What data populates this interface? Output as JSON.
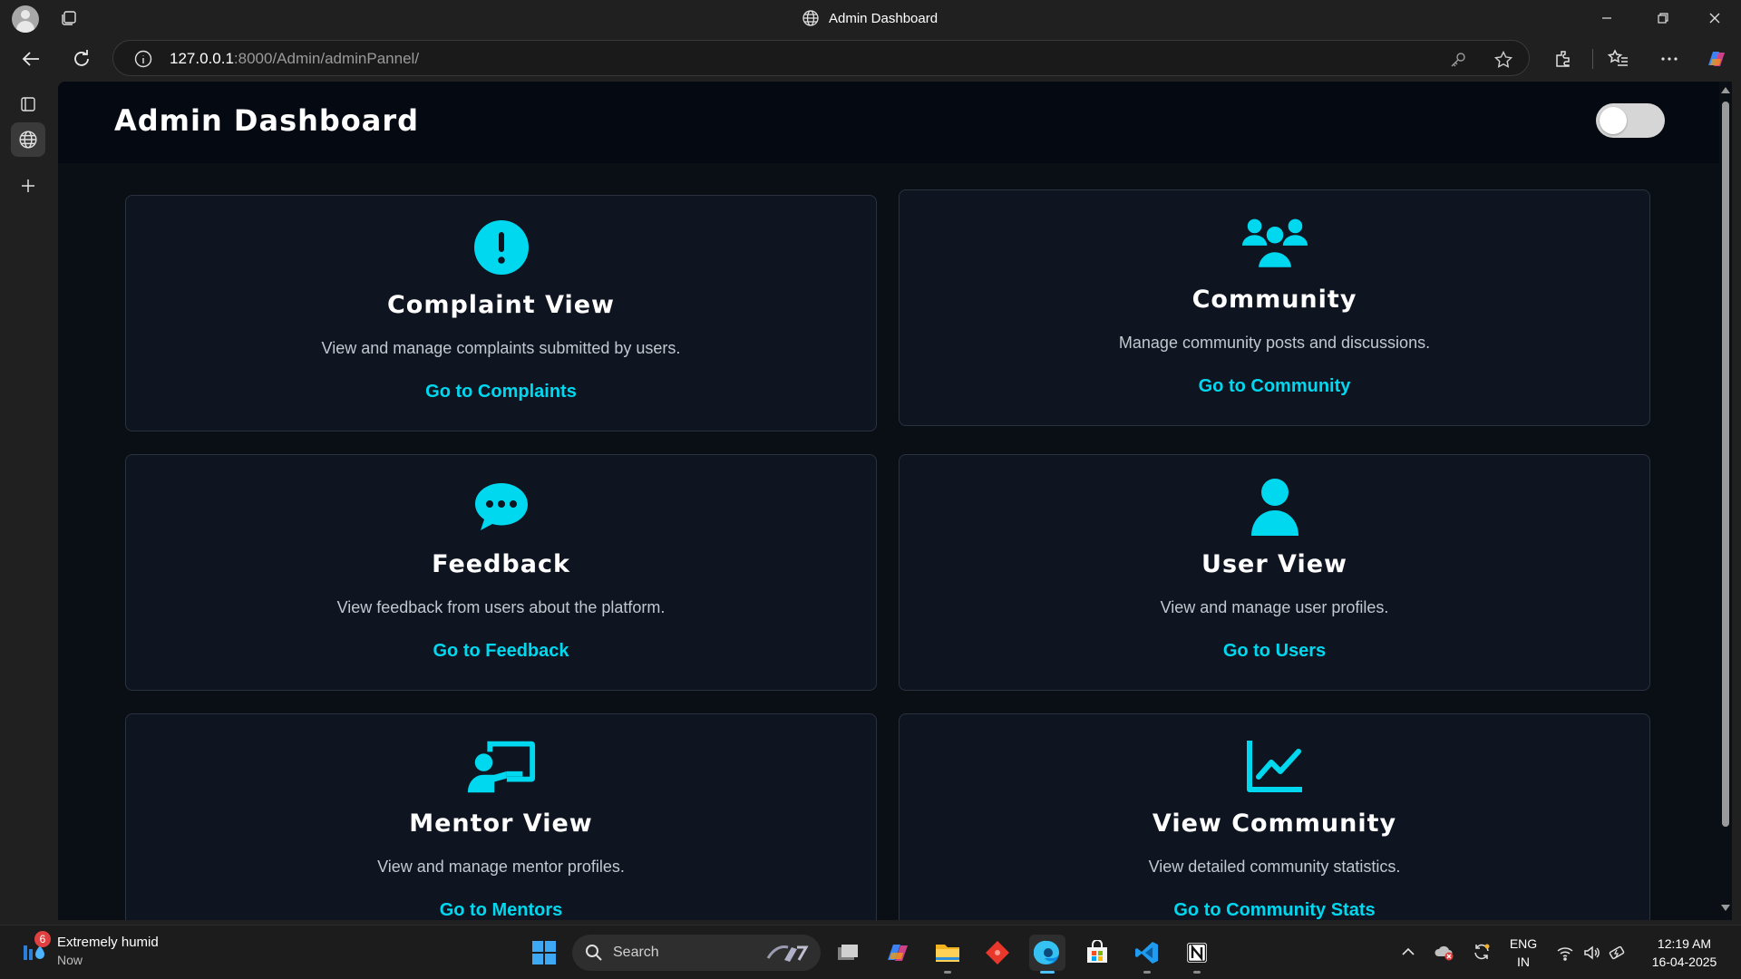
{
  "window": {
    "title": "Admin Dashboard"
  },
  "browser": {
    "url_host": "127.0.0.1",
    "url_path": ":8000/Admin/adminPannel/"
  },
  "page": {
    "title": "Admin Dashboard",
    "theme_toggle_on": false
  },
  "cards": [
    {
      "icon": "exclamation-circle-icon",
      "title": "Complaint View",
      "description": "View and manage complaints submitted by users.",
      "link": "Go to Complaints"
    },
    {
      "icon": "users-group-icon",
      "title": "Community",
      "description": "Manage community posts and discussions.",
      "link": "Go to Community"
    },
    {
      "icon": "chat-bubble-icon",
      "title": "Feedback",
      "description": "View feedback from users about the platform.",
      "link": "Go to Feedback"
    },
    {
      "icon": "user-icon",
      "title": "User View",
      "description": "View and manage user profiles.",
      "link": "Go to Users"
    },
    {
      "icon": "chalkboard-teacher-icon",
      "title": "Mentor View",
      "description": "View and manage mentor profiles.",
      "link": "Go to Mentors"
    },
    {
      "icon": "line-chart-icon",
      "title": "View Community",
      "description": "View detailed community statistics.",
      "link": "Go to Community Stats"
    }
  ],
  "colors": {
    "accent": "#00d8f0",
    "page_bg": "#0a0f16",
    "card_bg": "#0f1520",
    "card_border": "#2a323f"
  },
  "taskbar": {
    "weather_badge": "6",
    "weather_text": "Extremely humid",
    "weather_sub": "Now",
    "search_label": "Search",
    "lang_top": "ENG",
    "lang_bottom": "IN",
    "time": "12:19 AM",
    "date": "16-04-2025"
  }
}
